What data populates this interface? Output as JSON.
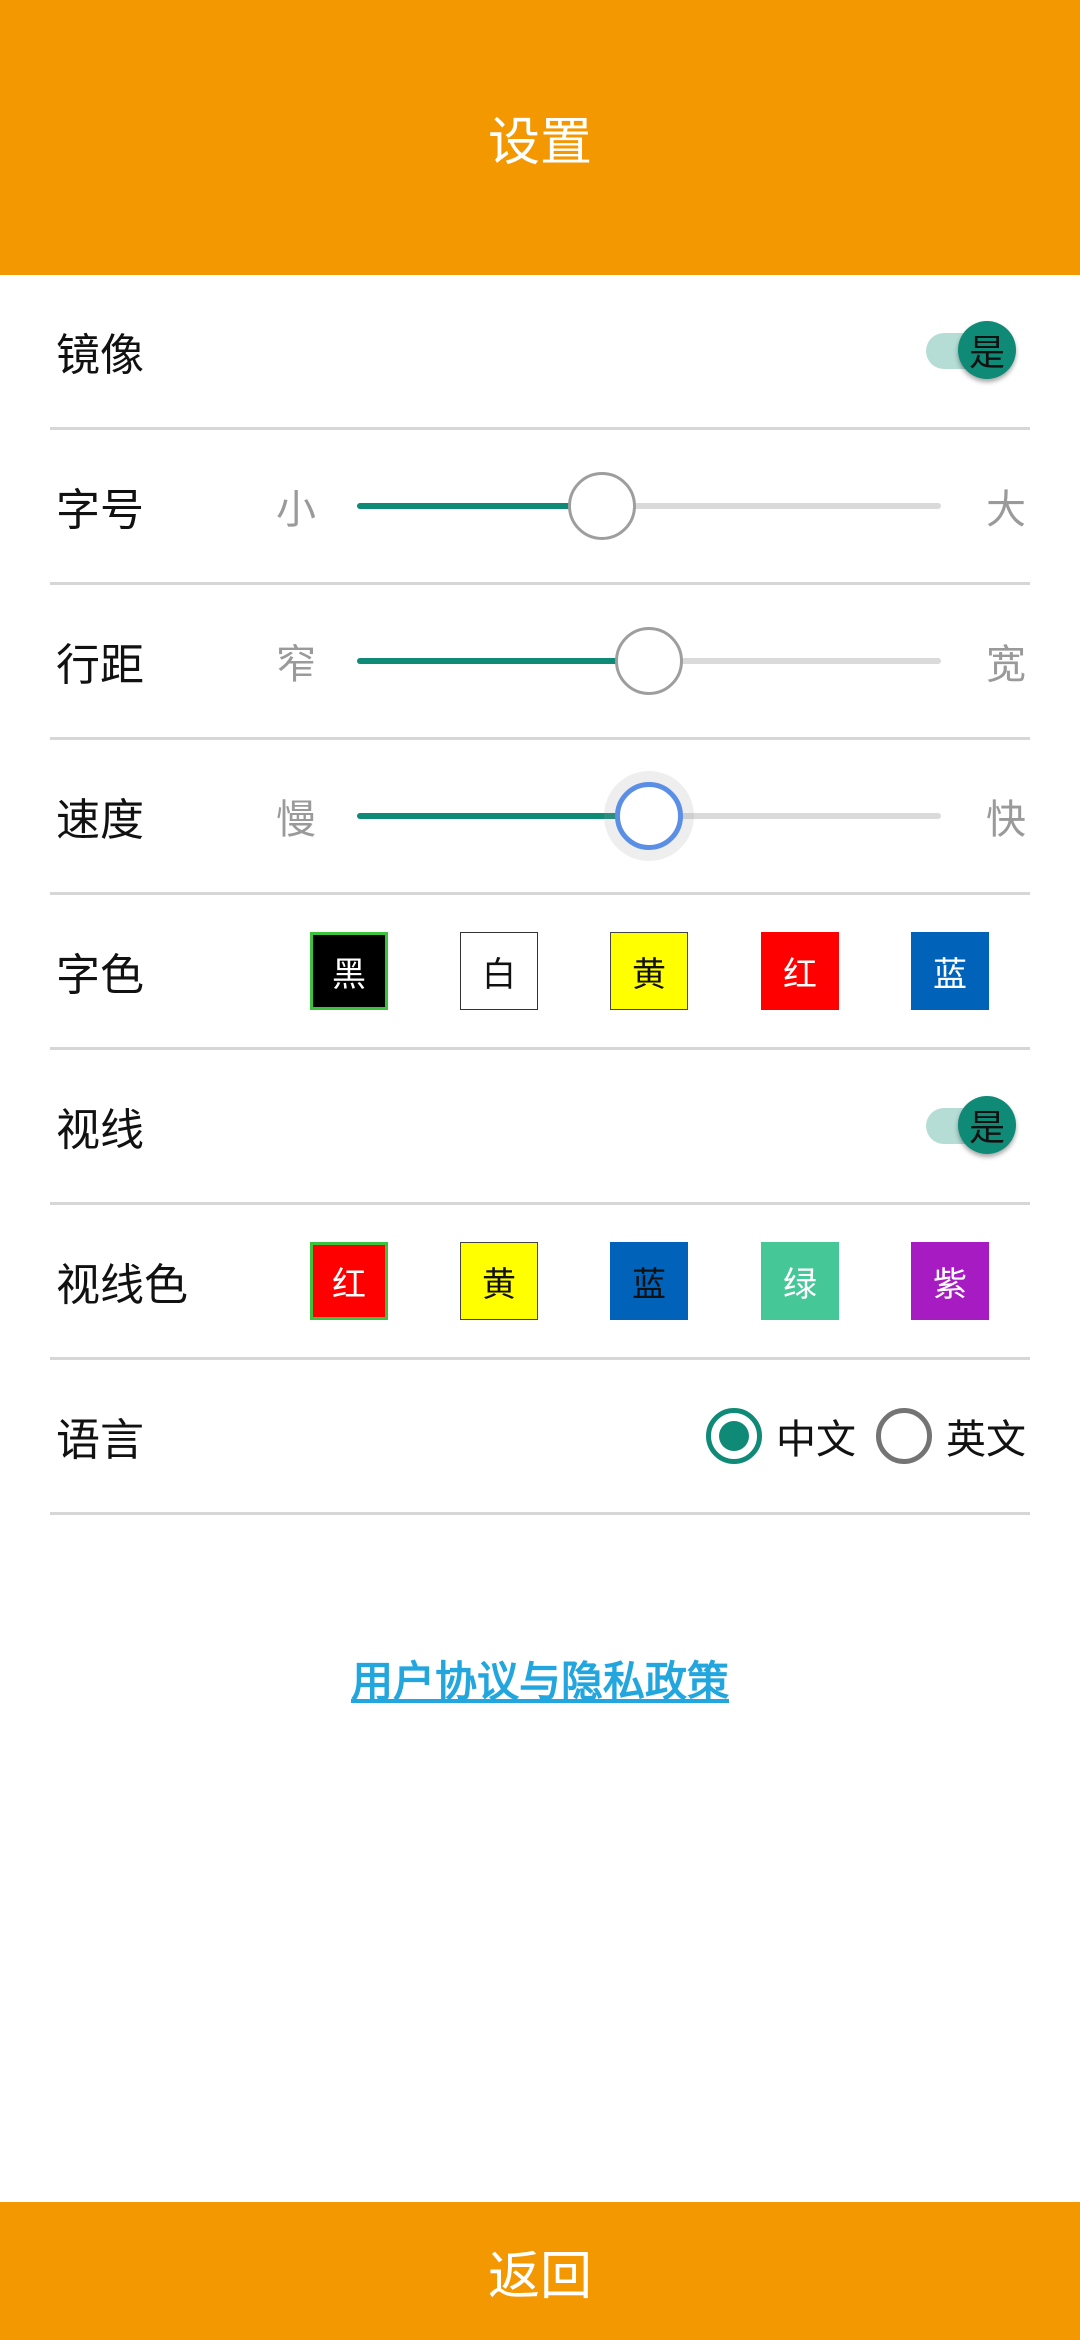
{
  "colors": {
    "accent": "#F39800",
    "primary": "#0F8A76",
    "link": "#23A6DE"
  },
  "header": {
    "title": "设置"
  },
  "rows": {
    "mirror": {
      "label": "镜像",
      "toggle_text": "是",
      "on": true
    },
    "font_size": {
      "label": "字号",
      "min": "小",
      "max": "大",
      "value_percent": 42
    },
    "line_spacing": {
      "label": "行距",
      "min": "窄",
      "max": "宽",
      "value_percent": 50
    },
    "speed": {
      "label": "速度",
      "min": "慢",
      "max": "快",
      "value_percent": 50
    },
    "font_color": {
      "label": "字色",
      "options": [
        {
          "label": "黑",
          "bg": "#000000",
          "fg": "#FFFFFF",
          "selected": true
        },
        {
          "label": "白",
          "bg": "#FFFFFF",
          "fg": "#111111",
          "selected": false
        },
        {
          "label": "黄",
          "bg": "#FFFF00",
          "fg": "#111111",
          "selected": false
        },
        {
          "label": "红",
          "bg": "#FF0000",
          "fg": "#FFFFFF",
          "selected": false
        },
        {
          "label": "蓝",
          "bg": "#0062B8",
          "fg": "#FFFFFF",
          "selected": false
        }
      ]
    },
    "sightline": {
      "label": "视线",
      "toggle_text": "是",
      "on": true
    },
    "sightline_color": {
      "label": "视线色",
      "options": [
        {
          "label": "红",
          "bg": "#FF0000",
          "fg": "#FFFFFF",
          "selected": true
        },
        {
          "label": "黄",
          "bg": "#FFFF00",
          "fg": "#111111",
          "selected": false
        },
        {
          "label": "蓝",
          "bg": "#0062B8",
          "fg": "#111111",
          "selected": false
        },
        {
          "label": "绿",
          "bg": "#45C797",
          "fg": "#FFFFFF",
          "selected": false
        },
        {
          "label": "紫",
          "bg": "#A61CC2",
          "fg": "#FFFFFF",
          "selected": false
        }
      ]
    },
    "language": {
      "label": "语言",
      "options": [
        "中文",
        "英文"
      ],
      "selected": "中文"
    }
  },
  "link": {
    "text": "用户协议与隐私政策"
  },
  "footer": {
    "back_label": "返回"
  }
}
